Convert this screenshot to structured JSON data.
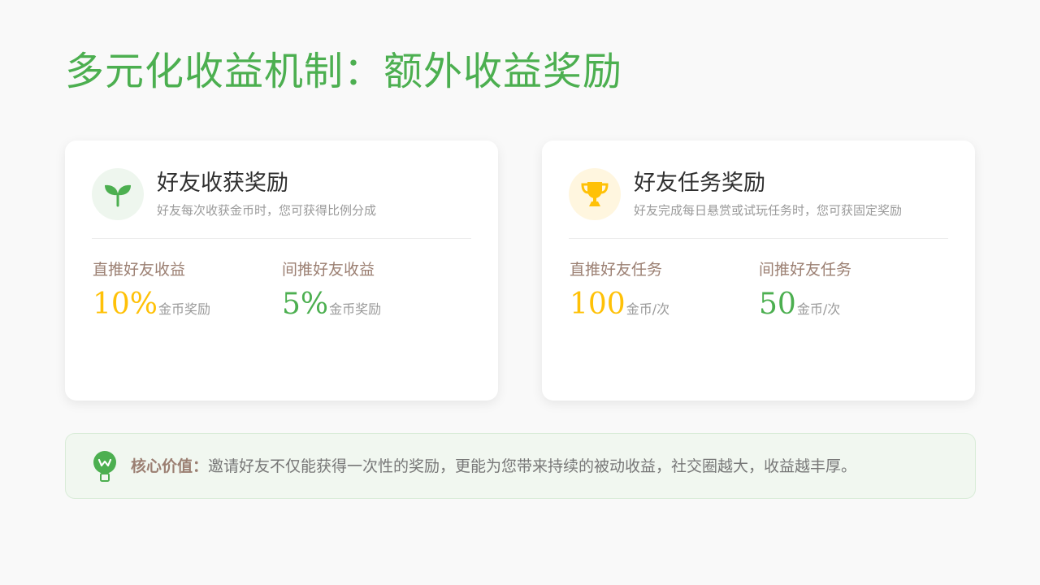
{
  "colors": {
    "brand_green": "#4caf50",
    "gold": "#ffc107",
    "label_brown": "#9b7f72",
    "banner_text": "#777777"
  },
  "title": "多元化收益机制：额外收益奖励",
  "cards": [
    {
      "icon": "sprout-icon",
      "title": "好友收获奖励",
      "subtitle": "好友每次收获金币时，您可获得比例分成",
      "metrics": [
        {
          "label": "直推好友收益",
          "value": "10%",
          "unit": "金币奖励"
        },
        {
          "label": "间推好友收益",
          "value": "5%",
          "unit": "金币奖励"
        }
      ]
    },
    {
      "icon": "trophy-icon",
      "title": "好友任务奖励",
      "subtitle": "好友完成每日悬赏或试玩任务时，您可获固定奖励",
      "metrics": [
        {
          "label": "直推好友任务",
          "value": "100",
          "unit": "金币/次"
        },
        {
          "label": "间推好友任务",
          "value": "50",
          "unit": "金币/次"
        }
      ]
    }
  ],
  "banner": {
    "icon": "lightbulb-icon",
    "label": "核心价值：",
    "text": "邀请好友不仅能获得一次性的奖励，更能为您带来持续的被动收益，社交圈越大，收益越丰厚。"
  }
}
